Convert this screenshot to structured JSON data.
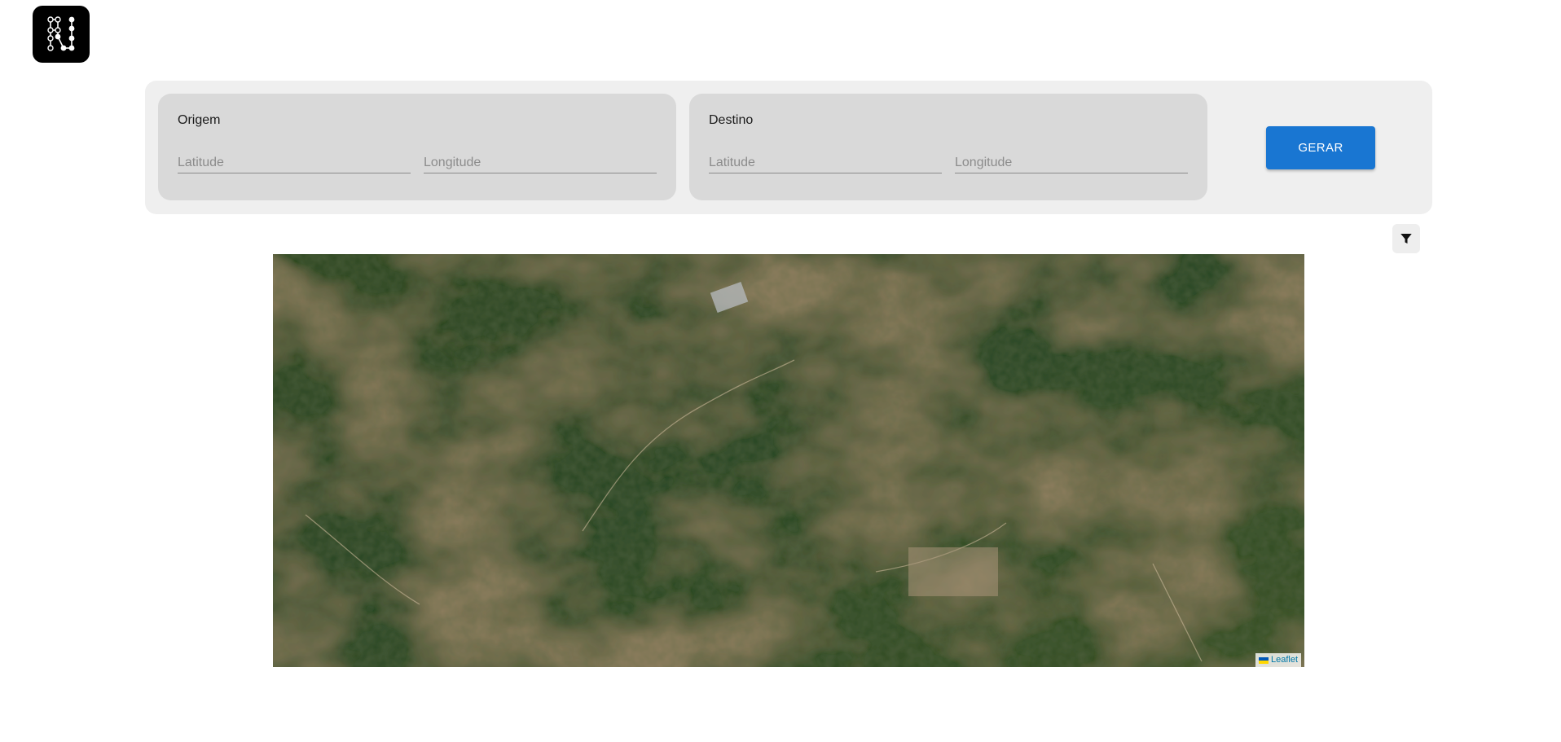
{
  "logo": {
    "icon": "graph-logo-icon"
  },
  "form": {
    "origin": {
      "title": "Origem",
      "latitude_placeholder": "Latitude",
      "longitude_placeholder": "Longitude",
      "latitude_value": "",
      "longitude_value": ""
    },
    "destination": {
      "title": "Destino",
      "latitude_placeholder": "Latitude",
      "longitude_placeholder": "Longitude",
      "latitude_value": "",
      "longitude_value": ""
    },
    "generate_label": "GERAR"
  },
  "filter": {
    "icon": "filter-icon"
  },
  "map": {
    "tiles": "satellite imagery",
    "attribution_label": "Leaflet"
  },
  "colors": {
    "primary": "#1976d2",
    "panel_bg": "#efefef",
    "group_bg": "#d9d9d9",
    "logo_bg": "#000000"
  }
}
